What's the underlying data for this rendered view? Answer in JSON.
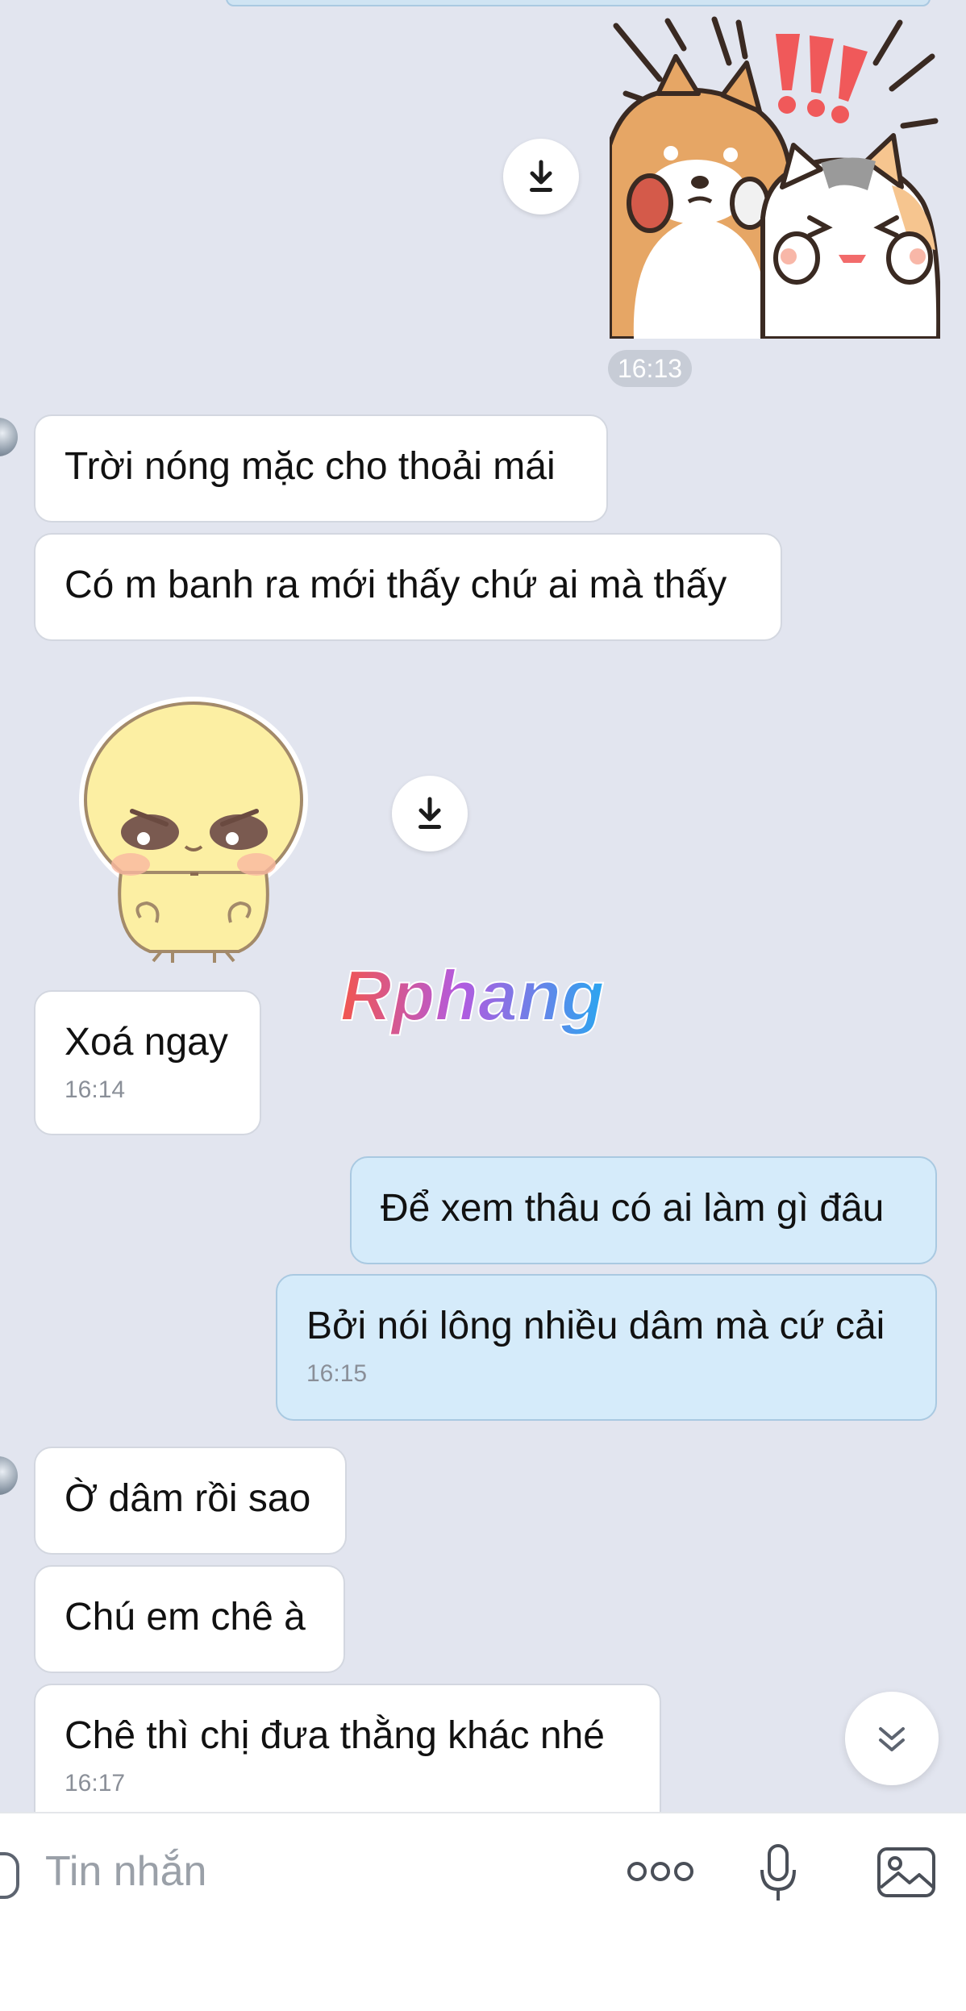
{
  "messages": {
    "sticker1_time": "16:13",
    "m1": "Trời nóng mặc cho thoải mái",
    "m2": "Có m banh ra mới thấy chứ ai mà thấy",
    "m3": "Xoá ngay",
    "m3_time": "16:14",
    "m4": "Để xem thâu có ai làm gì đâu",
    "m5": "Bởi nói lông nhiều dâm mà cứ cải",
    "m5_time": "16:15",
    "m6": "Ờ dâm rồi sao",
    "m7": "Chú em chê à",
    "m8": "Chê thì chị đưa thằng khác nhé",
    "m8_time": "16:17"
  },
  "watermark": {
    "text": "Rphang"
  },
  "input": {
    "placeholder": "Tin nhắn"
  },
  "icons": {
    "download": "download-icon",
    "scroll_down": "chevron-double-down-icon",
    "emoji": "emoji-icon",
    "more": "more-icon",
    "mic": "microphone-icon",
    "gallery": "image-icon"
  },
  "colors": {
    "background": "#e2e5ef",
    "incoming_bubble": "#ffffff",
    "outgoing_bubble": "#d5ebfa",
    "outgoing_border": "#a9c9e1"
  }
}
